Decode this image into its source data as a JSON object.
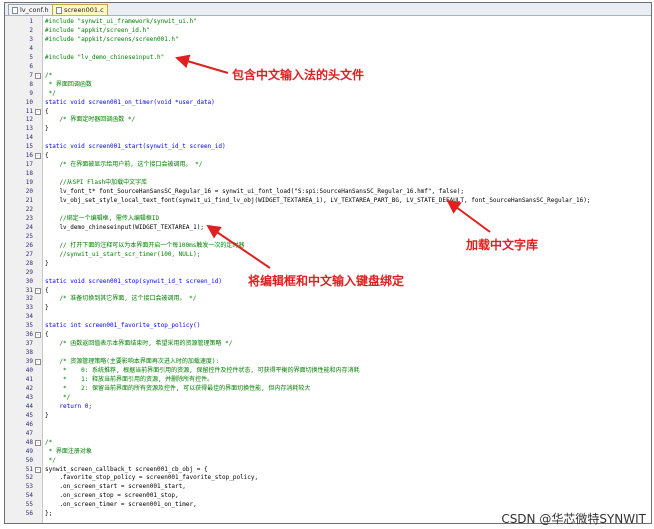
{
  "tabs": [
    {
      "label": "lv_conf.h",
      "active": false
    },
    {
      "label": "screen001.c",
      "active": true
    }
  ],
  "code_lines": [
    {
      "n": "1",
      "t": "#include \"synwit_ui_framework/synwit_ui.h\"",
      "k": "pp"
    },
    {
      "n": "2",
      "t": "#include \"appkit/screen_id.h\"",
      "k": "pp"
    },
    {
      "n": "3",
      "t": "#include \"appkit/screens/screen001.h\"",
      "k": "pp"
    },
    {
      "n": "4",
      "t": "",
      "k": "nm"
    },
    {
      "n": "5",
      "t": "#include \"lv_demo_chineseinput.h\"",
      "k": "pp"
    },
    {
      "n": "6",
      "t": "",
      "k": "nm"
    },
    {
      "n": "7",
      "t": "/*",
      "k": "cm"
    },
    {
      "n": "8",
      "t": " * 界面回调函数",
      "k": "cm"
    },
    {
      "n": "9",
      "t": " */",
      "k": "cm"
    },
    {
      "n": "10",
      "t": "static void screen001_on_timer(void *user_data)",
      "k": "kw"
    },
    {
      "n": "11",
      "t": "{",
      "k": "nm"
    },
    {
      "n": "12",
      "t": "    /* 界面定时器回调函数 */",
      "k": "cm"
    },
    {
      "n": "13",
      "t": "}",
      "k": "nm"
    },
    {
      "n": "14",
      "t": "",
      "k": "nm"
    },
    {
      "n": "15",
      "t": "static void screen001_start(synwit_id_t screen_id)",
      "k": "kw"
    },
    {
      "n": "16",
      "t": "{",
      "k": "nm"
    },
    {
      "n": "17",
      "t": "    /* 在界面被显示给用户前, 这个接口会被调用。 */",
      "k": "cm"
    },
    {
      "n": "18",
      "t": "",
      "k": "nm"
    },
    {
      "n": "19",
      "t": "    //从SPI Flash中加载中文字库",
      "k": "cm"
    },
    {
      "n": "20",
      "t": "    lv_font_t* font_SourceHanSansSC_Regular_16 = synwit_ui_font_load(\"S:spi:SourceHanSansSC_Regular_16.hmf\", false);",
      "k": "nm"
    },
    {
      "n": "21",
      "t": "    lv_obj_set_style_local_text_font(synwit_ui_find_lv_obj(WIDGET_TEXTAREA_1), LV_TEXTAREA_PART_BG, LV_STATE_DEFAULT, font_SourceHanSansSC_Regular_16);",
      "k": "nm"
    },
    {
      "n": "22",
      "t": "",
      "k": "nm"
    },
    {
      "n": "23",
      "t": "    //绑定一个编辑框, 需传入编辑框ID",
      "k": "cm"
    },
    {
      "n": "24",
      "t": "    lv_demo_chineseinput(WIDGET_TEXTAREA_1);",
      "k": "nm"
    },
    {
      "n": "25",
      "t": "",
      "k": "nm"
    },
    {
      "n": "26",
      "t": "    // 打开下面的注释可以为本界面开启一个每100ms触发一次的定时器",
      "k": "cm"
    },
    {
      "n": "27",
      "t": "    //synwit_ui_start_scr_timer(100, NULL);",
      "k": "cm"
    },
    {
      "n": "28",
      "t": "}",
      "k": "nm"
    },
    {
      "n": "29",
      "t": "",
      "k": "nm"
    },
    {
      "n": "30",
      "t": "static void screen001_stop(synwit_id_t screen_id)",
      "k": "kw"
    },
    {
      "n": "31",
      "t": "{",
      "k": "nm"
    },
    {
      "n": "32",
      "t": "    /* 准备切换到其它界面, 这个接口会被调用。 */",
      "k": "cm"
    },
    {
      "n": "33",
      "t": "}",
      "k": "nm"
    },
    {
      "n": "34",
      "t": "",
      "k": "nm"
    },
    {
      "n": "35",
      "t": "static int screen001_favorite_stop_policy()",
      "k": "kw"
    },
    {
      "n": "36",
      "t": "{",
      "k": "nm"
    },
    {
      "n": "37",
      "t": "    /* 函数返回值表示本界面结束时, 希望采用的资源管理策略 */",
      "k": "cm"
    },
    {
      "n": "38",
      "t": "",
      "k": "nm"
    },
    {
      "n": "39",
      "t": "    /* 资源管理策略(主要影响本界面再次进入时的加载速度):",
      "k": "cm"
    },
    {
      "n": "40",
      "t": "     *    0: 系统推荐, 根据当前界面引用的资源, 保留控件及控件状态, 可获得平衡的界面切换性能和内存消耗",
      "k": "cm"
    },
    {
      "n": "41",
      "t": "     *    1: 释放当前界面引用的资源, 并删除所有控件。",
      "k": "cm"
    },
    {
      "n": "42",
      "t": "     *    2: 保留当前界面的所有资源及控件, 可以获得最佳的界面切换性能, 但内存消耗较大",
      "k": "cm"
    },
    {
      "n": "43",
      "t": "     */",
      "k": "cm"
    },
    {
      "n": "44",
      "t": "    return 0;",
      "k": "kw"
    },
    {
      "n": "45",
      "t": "}",
      "k": "nm"
    },
    {
      "n": "46",
      "t": "",
      "k": "nm"
    },
    {
      "n": "47",
      "t": "",
      "k": "nm"
    },
    {
      "n": "48",
      "t": "/*",
      "k": "cm"
    },
    {
      "n": "49",
      "t": " * 界面注册对象",
      "k": "cm"
    },
    {
      "n": "50",
      "t": " */",
      "k": "cm"
    },
    {
      "n": "51",
      "t": "synwit_screen_callback_t screen001_cb_obj = {",
      "k": "nm"
    },
    {
      "n": "52",
      "t": "    .favorite_stop_policy = screen001_favorite_stop_policy,",
      "k": "nm"
    },
    {
      "n": "53",
      "t": "    .on_screen_start = screen001_start,",
      "k": "nm"
    },
    {
      "n": "54",
      "t": "    .on_screen_stop = screen001_stop,",
      "k": "nm"
    },
    {
      "n": "55",
      "t": "    .on_screen_timer = screen001_on_timer,",
      "k": "nm"
    },
    {
      "n": "56",
      "t": "};",
      "k": "nm"
    }
  ],
  "annotations": {
    "header": "包含中文输入法的头文件",
    "font": "加载中文字库",
    "bind": "将编辑框和中文输入键盘绑定"
  },
  "accent_color": "#e02020",
  "credit": "CSDN @华芯微特SYNWIT"
}
